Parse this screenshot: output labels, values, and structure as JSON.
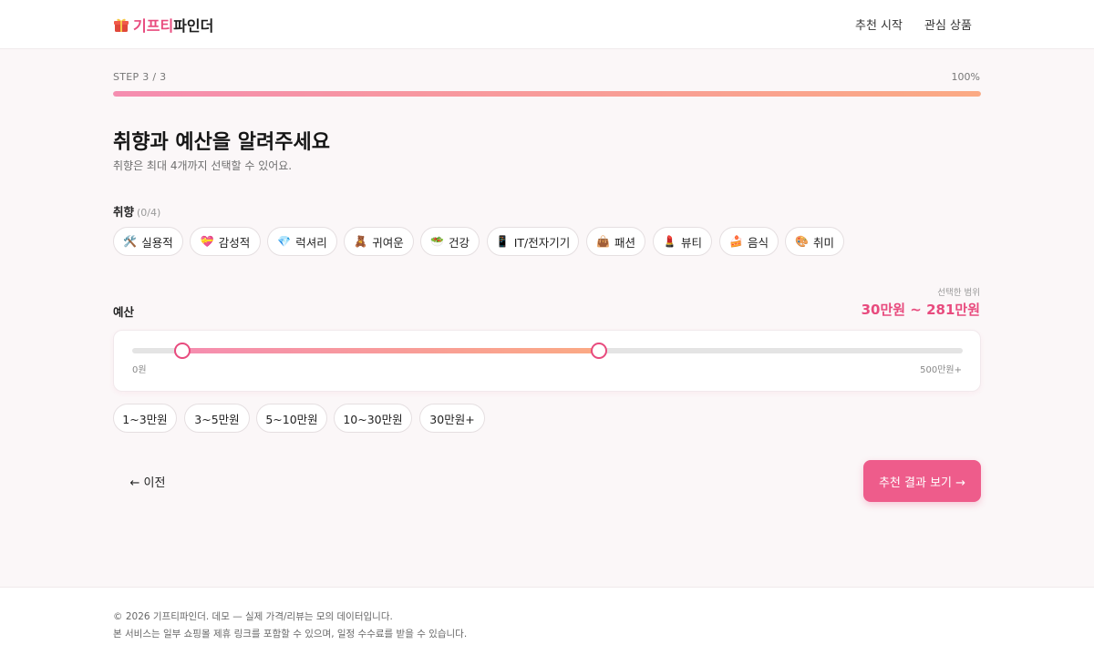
{
  "header": {
    "brand_accent": "기프티",
    "brand_rest": "파인더",
    "logo_icon": "gift-icon",
    "nav": [
      "추천 시작",
      "관심 상품"
    ]
  },
  "progress": {
    "step_label": "STEP 3 / 3",
    "percent_label": "100%",
    "percent": 100
  },
  "main": {
    "title": "취향과 예산을 알려주세요",
    "subtitle": "취향은 최대 4개까지 선택할 수 있어요."
  },
  "taste": {
    "label": "취향",
    "count": "(0/4)",
    "chips": [
      {
        "icon": "🛠️",
        "icon_name": "tools-icon",
        "label": "실용적"
      },
      {
        "icon": "💝",
        "icon_name": "heart-gift-icon",
        "label": "감성적"
      },
      {
        "icon": "💎",
        "icon_name": "gem-icon",
        "label": "럭셔리"
      },
      {
        "icon": "🧸",
        "icon_name": "teddy-bear-icon",
        "label": "귀여운"
      },
      {
        "icon": "🥗",
        "icon_name": "salad-icon",
        "label": "건강"
      },
      {
        "icon": "📱",
        "icon_name": "phone-icon",
        "label": "IT/전자기기"
      },
      {
        "icon": "👜",
        "icon_name": "handbag-icon",
        "label": "패션"
      },
      {
        "icon": "💄",
        "icon_name": "lipstick-icon",
        "label": "뷰티"
      },
      {
        "icon": "🍰",
        "icon_name": "cake-icon",
        "label": "음식"
      },
      {
        "icon": "🎨",
        "icon_name": "palette-icon",
        "label": "취미"
      }
    ]
  },
  "budget": {
    "label": "예산",
    "range_caption": "선택한 범위",
    "range_value": "30만원 ~ 281만원",
    "slider": {
      "min_label": "0원",
      "max_label": "500만원+",
      "min_value": 0,
      "max_value": 500,
      "low": 30,
      "high": 281
    },
    "presets": [
      "1~3만원",
      "3~5만원",
      "5~10만원",
      "10~30만원",
      "30만원+"
    ]
  },
  "actions": {
    "prev": "← 이전",
    "next": "추천 결과 보기 →"
  },
  "footer": {
    "line1": "© 2026 기프티파인더. 데모 — 실제 가격/리뷰는 모의 데이터입니다.",
    "line2": "본 서비스는 일부 쇼핑몰 제휴 링크를 포함할 수 있으며, 일정 수수료를 받을 수 있습니다."
  },
  "colors": {
    "accent": "#e84b7e",
    "button": "#ee5c8b",
    "gradient_start": "#f58db0",
    "gradient_end": "#fbaa84"
  }
}
